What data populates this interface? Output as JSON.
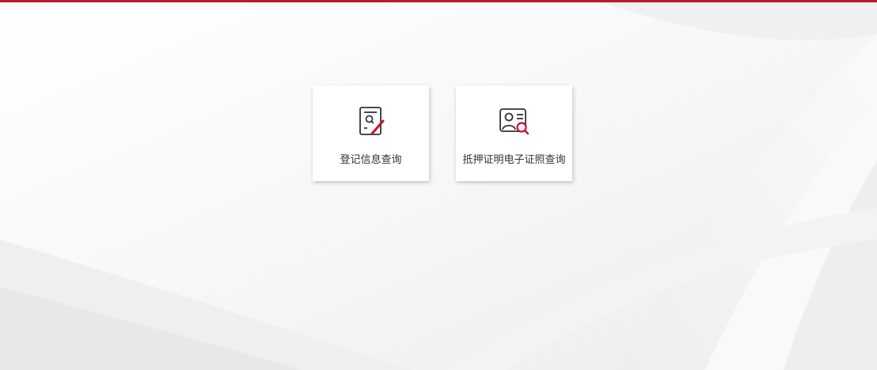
{
  "header": {
    "accent_color": "#b81c2c"
  },
  "cards": [
    {
      "label": "登记信息查询",
      "icon": "document-search-edit-icon"
    },
    {
      "label": "抵押证明电子证照查询",
      "icon": "id-card-search-icon"
    }
  ]
}
